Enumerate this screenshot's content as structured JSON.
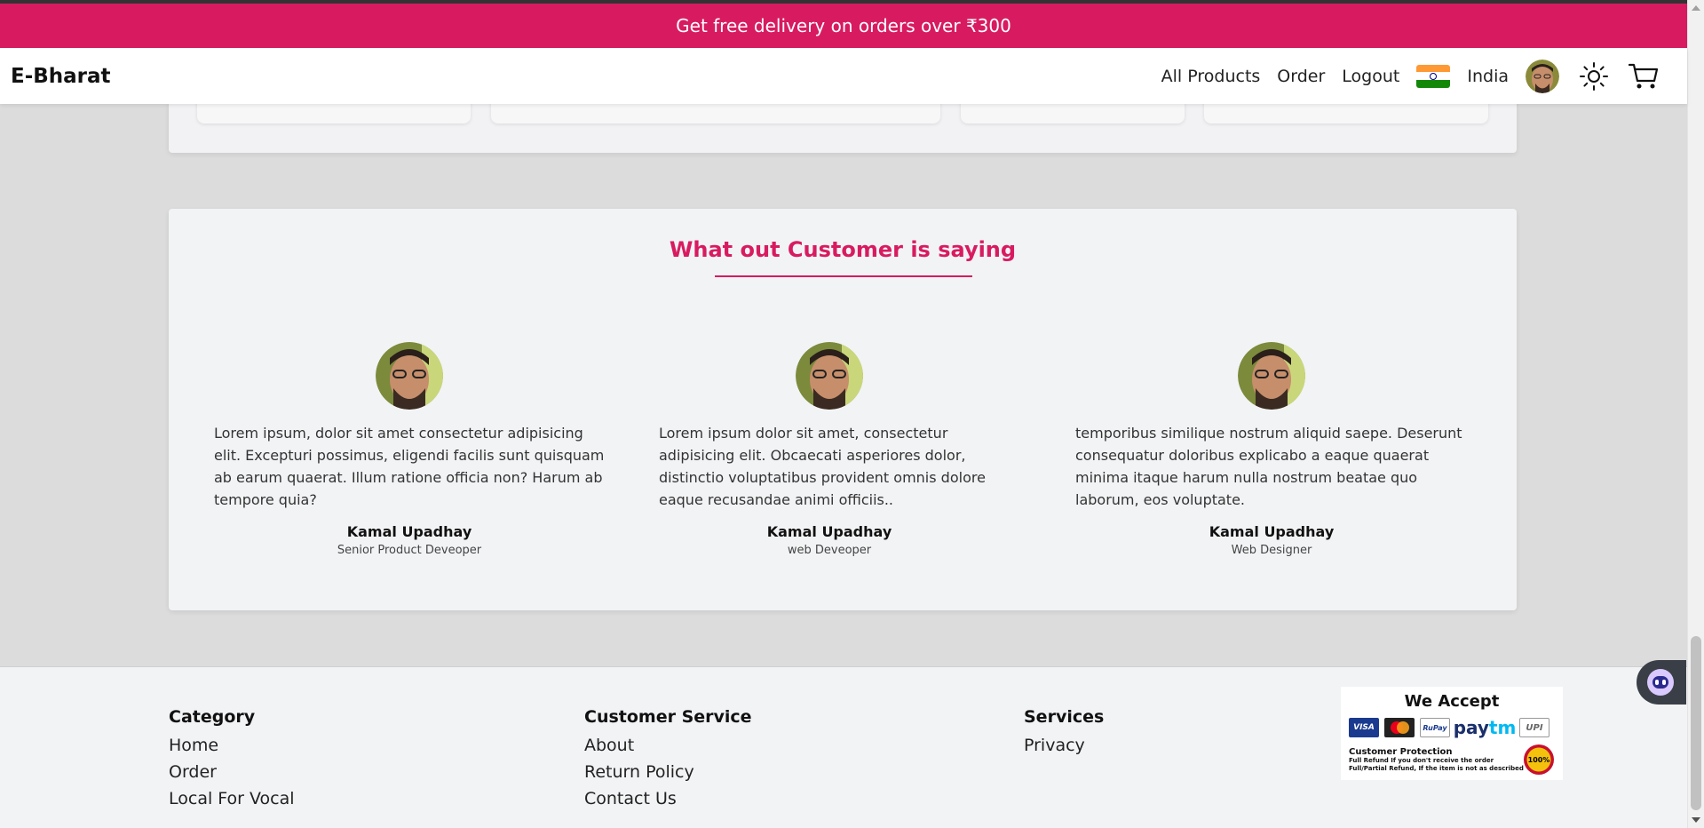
{
  "promo_banner": {
    "text": "Get free delivery on orders over ₹300"
  },
  "navbar": {
    "brand": "E-Bharat",
    "links": [
      "All Products",
      "Order",
      "Logout"
    ],
    "country": "India",
    "icons": [
      "india-flag-icon",
      "user-avatar",
      "sun-icon",
      "cart-icon"
    ]
  },
  "testimonials": {
    "heading": "What out Customer is saying",
    "items": [
      {
        "text": "Lorem ipsum, dolor sit amet consectetur adipisicing elit. Excepturi possimus, eligendi facilis sunt quisquam ab earum quaerat. Illum ratione officia non? Harum ab tempore quia?",
        "name": "Kamal Upadhay",
        "role": "Senior Product Deveoper"
      },
      {
        "text": "Lorem ipsum dolor sit amet, consectetur adipisicing elit. Obcaecati asperiores dolor, distinctio voluptatibus provident omnis dolore eaque recusandae animi officiis..",
        "name": "Kamal Upadhay",
        "role": "web Deveoper"
      },
      {
        "text": "temporibus similique nostrum aliquid saepe. Deserunt consequatur doloribus explicabo a eaque quaerat minima itaque harum nulla nostrum beatae quo laborum, eos voluptate.",
        "name": "Kamal Upadhay",
        "role": "Web Designer"
      }
    ]
  },
  "footer": {
    "columns": [
      {
        "heading": "Category",
        "links": [
          "Home",
          "Order",
          "Local For Vocal"
        ]
      },
      {
        "heading": "Customer Service",
        "links": [
          "About",
          "Return Policy",
          "Contact Us"
        ]
      },
      {
        "heading": "Services",
        "links": [
          "Privacy"
        ]
      }
    ],
    "we_accept": {
      "title": "We Accept",
      "methods": [
        "VISA",
        "Mastercard",
        "RuPay",
        "paytm",
        "UPI"
      ],
      "protection_title": "Customer Protection",
      "protection_lines": [
        "Full Refund If you don't receive the order",
        "Full/Partial Refund, If the item is not as described"
      ],
      "badge": "100%"
    }
  },
  "colors": {
    "accent": "#d81b60",
    "page_bg": "#dcdcdc",
    "card_bg": "#f2f3f5"
  }
}
